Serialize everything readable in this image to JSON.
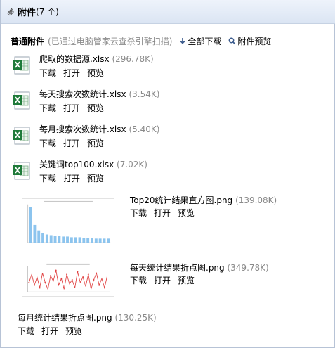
{
  "header": {
    "title": "附件",
    "count": "(7 个)"
  },
  "toolbar": {
    "normal_label": "普通附件",
    "scan_note": "(已通过电脑管家云查杀引擎扫描)",
    "download_all": "全部下载",
    "preview_all": "附件预览"
  },
  "actions": {
    "download": "下载",
    "open": "打开",
    "preview": "预览"
  },
  "files": [
    {
      "name": "爬取的数据源.xlsx",
      "size": "(296.78K)",
      "icon": "excel-icon"
    },
    {
      "name": "每天搜索次数统计.xlsx",
      "size": "(3.54K)",
      "icon": "excel-icon"
    },
    {
      "name": "每月搜索次数统计.xlsx",
      "size": "(5.40K)",
      "icon": "excel-icon"
    },
    {
      "name": "关键词top100.xlsx",
      "size": "(7.02K)",
      "icon": "excel-icon"
    },
    {
      "name": "Top20统计结果直方图.png",
      "size": "(139.08K)",
      "icon": "bar-chart-thumbnail"
    },
    {
      "name": "每天统计结果折点图.png",
      "size": "(349.78K)",
      "icon": "line-chart-thumbnail"
    },
    {
      "name": "每月统计结果折点图.png",
      "size": "(130.25K)",
      "icon": "image"
    }
  ],
  "colors": {
    "excel_green": "#1f7a3a",
    "header_bg": "#dbe5f3",
    "size_gray": "#8a8a8a",
    "thumb_blue": "#8cc4ee",
    "thumb_red": "#e04040"
  }
}
